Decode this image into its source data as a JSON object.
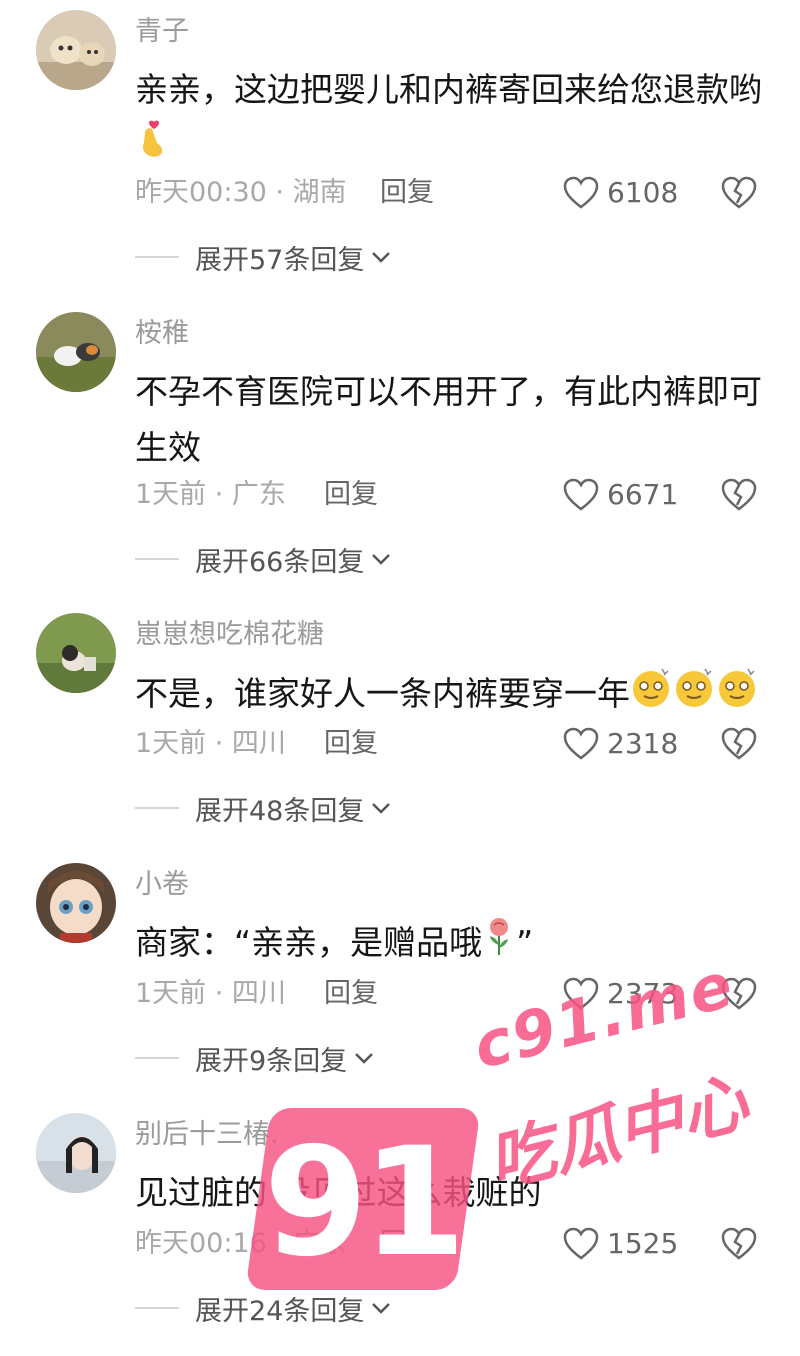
{
  "comments": [
    {
      "username": "青子",
      "text": "亲亲，这边把婴儿和内裤寄回来给您退款哟",
      "emoji": "finger-heart-emoji",
      "meta": "昨天00:30 · 湖南",
      "reply_label": "回复",
      "likes": "6108",
      "expand_label": "展开57条回复"
    },
    {
      "username": "桉稚",
      "text": "不孕不育医院可以不用开了，有此内裤即可生效",
      "emoji": "",
      "meta": "1天前 · 广东",
      "reply_label": "回复",
      "likes": "6671",
      "expand_label": "展开66条回复"
    },
    {
      "username": "崽崽想吃棉花糖",
      "text": "不是，谁家好人一条内裤要穿一年",
      "emoji": "dizzy-face-emoji x3",
      "meta": "1天前 · 四川",
      "reply_label": "回复",
      "likes": "2318",
      "expand_label": "展开48条回复"
    },
    {
      "username": "小卷",
      "text": "商家：“亲亲，是赠品哦",
      "text_tail": "”",
      "emoji": "rose-emoji",
      "meta": "1天前 · 四川",
      "reply_label": "回复",
      "likes": "2373",
      "expand_label": "展开9条回复"
    },
    {
      "username": "别后十三椿.",
      "text": "见过脏的 没见过这么栽赃的",
      "emoji": "",
      "meta": "昨天00:16 · 广东",
      "reply_label": "回复",
      "likes": "1525",
      "expand_label": "展开24条回复"
    }
  ],
  "icons": {
    "like": "heart-outline-icon",
    "dislike": "broken-heart-icon",
    "expand": "chevron-down-icon"
  },
  "watermark": {
    "number": "91",
    "site": "c91.me",
    "name": "吃瓜中心",
    "color": "#f75282"
  }
}
